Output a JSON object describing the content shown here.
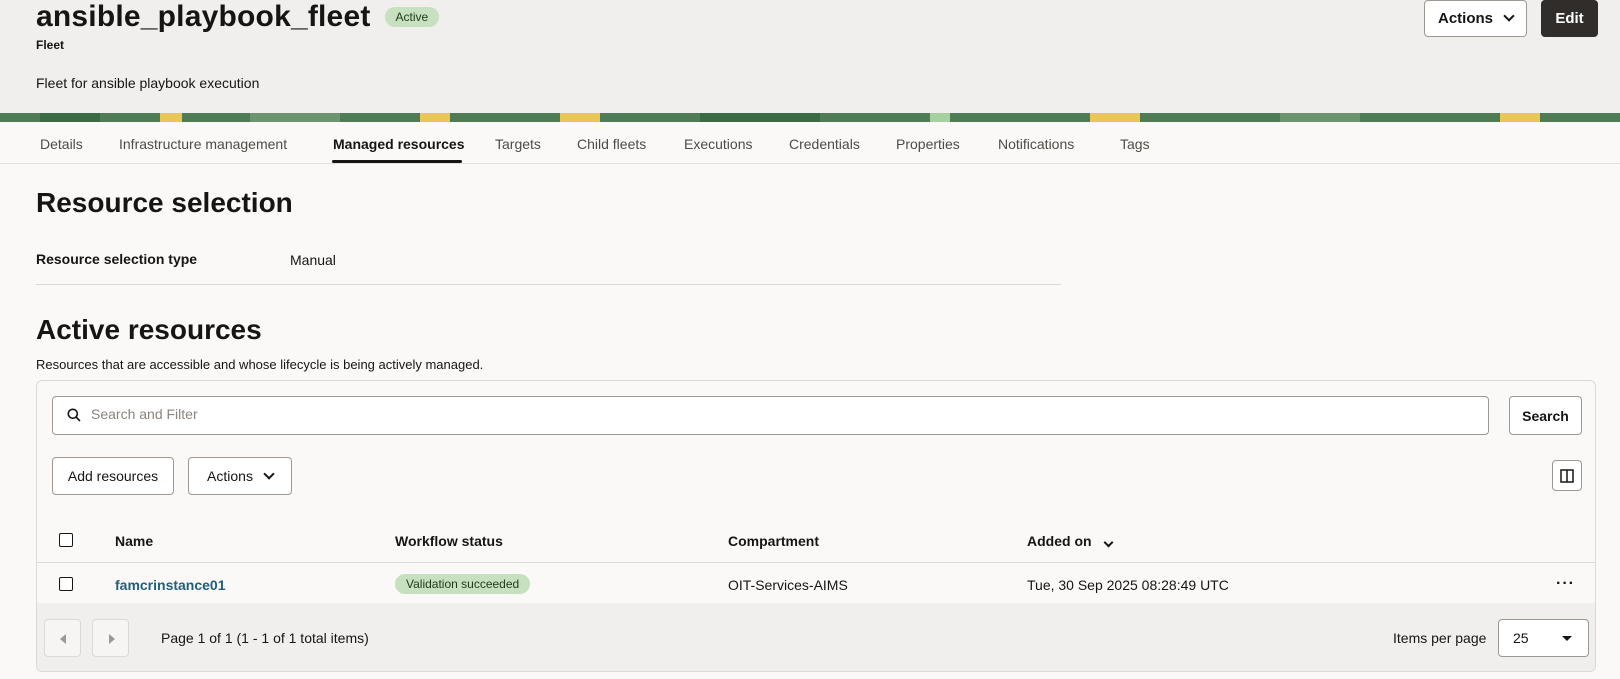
{
  "header": {
    "title": "ansible_playbook_fleet",
    "status": "Active",
    "subtitle": "Fleet",
    "description": "Fleet for ansible playbook execution",
    "actions_label": "Actions",
    "edit_label": "Edit"
  },
  "tabs": [
    {
      "label": "Details"
    },
    {
      "label": "Infrastructure management"
    },
    {
      "label": "Managed resources",
      "active": true
    },
    {
      "label": "Targets"
    },
    {
      "label": "Child fleets"
    },
    {
      "label": "Executions"
    },
    {
      "label": "Credentials"
    },
    {
      "label": "Properties"
    },
    {
      "label": "Notifications"
    },
    {
      "label": "Tags"
    }
  ],
  "resource_selection": {
    "heading": "Resource selection",
    "type_label": "Resource selection type",
    "type_value": "Manual"
  },
  "active_resources": {
    "heading": "Active resources",
    "description": "Resources that are accessible and whose lifecycle is being actively managed.",
    "search_placeholder": "Search and Filter",
    "search_button": "Search",
    "add_button": "Add resources",
    "actions_button": "Actions",
    "columns": [
      "Name",
      "Workflow status",
      "Compartment",
      "Added on"
    ],
    "rows": [
      {
        "name": "famcrinstance01",
        "status": "Validation succeeded",
        "compartment": "OIT-Services-AIMS",
        "added_on": "Tue, 30 Sep 2025 08:28:49 UTC"
      }
    ],
    "pagination": {
      "info": "Page 1 of 1 (1 - 1 of 1 total items)",
      "items_per_page_label": "Items per page",
      "items_per_page": "25"
    }
  },
  "colors": {
    "badge_green": "#c7e0bf",
    "link": "#1e5f7a",
    "primary_button": "#312d2a",
    "banner_green": "#4f7c54"
  }
}
